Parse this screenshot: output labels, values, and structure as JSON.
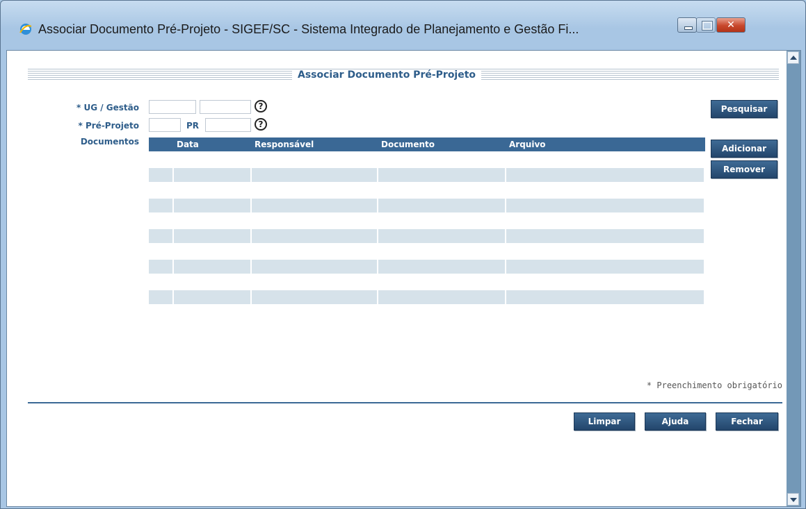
{
  "window": {
    "title": "Associar Documento Pré-Projeto - SIGEF/SC - Sistema Integrado de Planejamento e Gestão Fi..."
  },
  "form": {
    "heading": "Associar Documento Pré-Projeto",
    "ug_label": "* UG / Gestão",
    "preprojeto_label": "* Pré-Projeto",
    "pr_label": "PR",
    "documentos_label": "Documentos",
    "help_glyph": "?",
    "ug_value": "",
    "gestao_value": "",
    "preprojeto_value": "",
    "pr_value": ""
  },
  "buttons": {
    "pesquisar": "Pesquisar",
    "adicionar": "Adicionar",
    "remover": "Remover",
    "limpar": "Limpar",
    "ajuda": "Ajuda",
    "fechar": "Fechar"
  },
  "table": {
    "columns": [
      "",
      "Data",
      "Responsável",
      "Documento",
      "Arquivo"
    ],
    "rows": [
      [
        "",
        "",
        "",
        "",
        ""
      ],
      [
        "",
        "",
        "",
        "",
        ""
      ],
      [
        "",
        "",
        "",
        "",
        ""
      ],
      [
        "",
        "",
        "",
        "",
        ""
      ],
      [
        "",
        "",
        "",
        "",
        ""
      ]
    ]
  },
  "footer": {
    "required_note": "* Preenchimento obrigatório"
  },
  "colors": {
    "accent": "#3a6895",
    "label": "#2e5d8a",
    "row_fill": "#d6e2ea"
  }
}
